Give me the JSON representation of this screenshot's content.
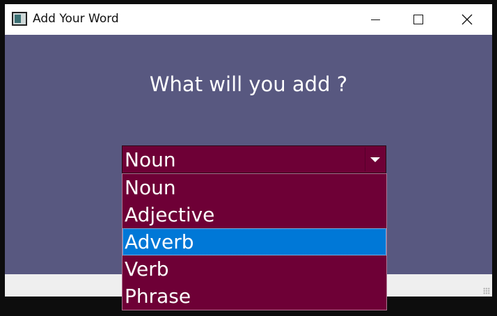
{
  "window": {
    "title": "Add Your Word"
  },
  "main": {
    "question": "What will you add ?"
  },
  "combo": {
    "selected": "Noun"
  },
  "dropdown": {
    "options": [
      "Noun",
      "Adjective",
      "Adverb",
      "Verb",
      "Phrase"
    ],
    "highlighted_index": 2
  },
  "colors": {
    "client_bg": "#585880",
    "combo_bg": "#6e0036",
    "highlight": "#0078d7"
  },
  "icons": {
    "app": "app-window-icon",
    "minimize": "minimize-icon",
    "maximize": "maximize-icon",
    "close": "close-icon",
    "dropdown": "chevron-down-icon"
  }
}
